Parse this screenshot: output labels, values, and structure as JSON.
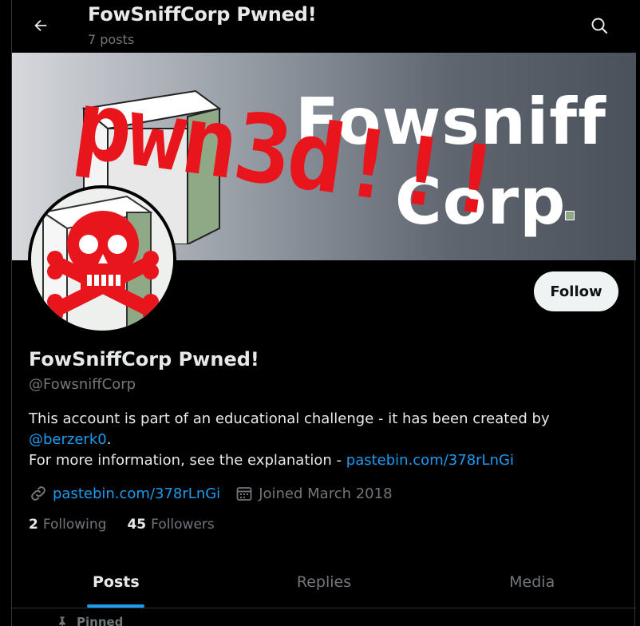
{
  "header": {
    "title": "FowSniffCorp Pwned!",
    "posts_count": "7 posts"
  },
  "banner": {
    "word1": "Fowsniff",
    "word2": "Corp",
    "overlay": "pwn3d!!!"
  },
  "profile": {
    "display_name": "FowSniffCorp Pwned!",
    "handle": "@FowsniffCorp",
    "follow_label": "Follow",
    "bio_line1": "This account is part of an educational challenge - it has been created by",
    "bio_mention": "@berzerk0",
    "bio_period": ".",
    "bio_line3_text": "For more information, see the explanation - ",
    "bio_line3_link": "pastebin.com/378rLnGi",
    "website": "pastebin.com/378rLnGi",
    "joined": "Joined March 2018",
    "following_count": "2",
    "following_label": "Following",
    "followers_count": "45",
    "followers_label": "Followers"
  },
  "tabs": [
    {
      "label": "Posts",
      "active": true
    },
    {
      "label": "Replies",
      "active": false
    },
    {
      "label": "Media",
      "active": false
    }
  ],
  "pinned_label": "Pinned",
  "colors": {
    "accent": "#1d9bf0",
    "background": "#000000",
    "muted": "#71767b",
    "pwn_red": "#e8151d"
  },
  "icons": [
    "back-arrow-icon",
    "search-icon",
    "link-icon",
    "calendar-icon",
    "pin-icon",
    "skull-crossbones-icon"
  ]
}
